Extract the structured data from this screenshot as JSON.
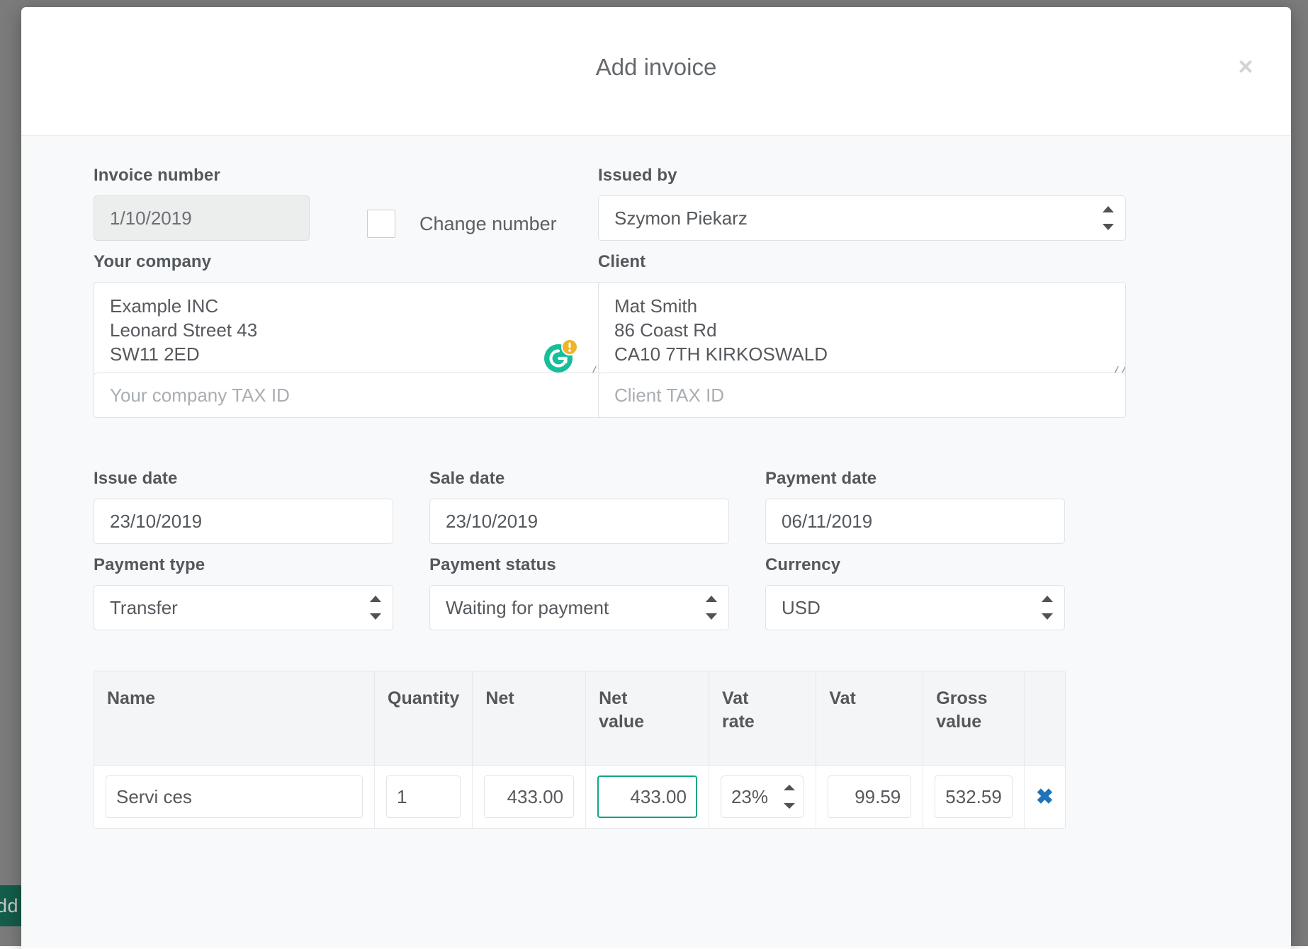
{
  "background": {
    "add_button_label": "Add"
  },
  "modal": {
    "title": "Add invoice",
    "close_label": "×"
  },
  "invoice": {
    "number_label": "Invoice number",
    "number_value": "1/10/2019",
    "change_number_label": "Change number",
    "issued_by_label": "Issued by",
    "issued_by_value": "Szymon Piekarz"
  },
  "company": {
    "label": "Your company",
    "lines": [
      "Example INC",
      "Leonard Street 43",
      "SW11 2ED"
    ],
    "tax_id_placeholder": "Your company TAX ID",
    "tax_id_value": ""
  },
  "client": {
    "label": "Client",
    "lines": [
      "Mat Smith",
      "86 Coast Rd",
      "CA10 7TH KIRKOSWALD"
    ],
    "tax_id_placeholder": "Client TAX ID",
    "tax_id_value": ""
  },
  "dates": {
    "issue_label": "Issue date",
    "issue_value": "23/10/2019",
    "sale_label": "Sale date",
    "sale_value": "23/10/2019",
    "payment_label": "Payment date",
    "payment_value": "06/11/2019"
  },
  "payment": {
    "type_label": "Payment type",
    "type_value": "Transfer",
    "status_label": "Payment status",
    "status_value": "Waiting for payment",
    "currency_label": "Currency",
    "currency_value": "USD"
  },
  "items": {
    "columns": [
      "Name",
      "Quantity",
      "Net",
      "Net value",
      "Vat rate",
      "Vat",
      "Gross value",
      ""
    ],
    "column_lines": {
      "name": [
        "Name",
        ""
      ],
      "quantity": [
        "Quantity",
        ""
      ],
      "net": [
        "Net",
        ""
      ],
      "net_value": [
        "Net",
        "value"
      ],
      "vat_rate": [
        "Vat",
        "rate"
      ],
      "vat": [
        "Vat",
        ""
      ],
      "gross_value": [
        "Gross",
        "value"
      ]
    },
    "rows": [
      {
        "name": "Servi ces",
        "quantity": "1",
        "net": "433.00",
        "net_value": "433.00",
        "vat_rate": "23%",
        "vat": "99.59",
        "gross_value": "532.59",
        "delete_label": "✖"
      }
    ]
  },
  "icons": {
    "grammarly": "grammarly-icon",
    "grammarly_color": "#15bf9a",
    "grammarly_badge_color": "#f0b429",
    "focus_color": "#11a683",
    "delete_color": "#1e73be",
    "resize_grip": "╱╱"
  }
}
